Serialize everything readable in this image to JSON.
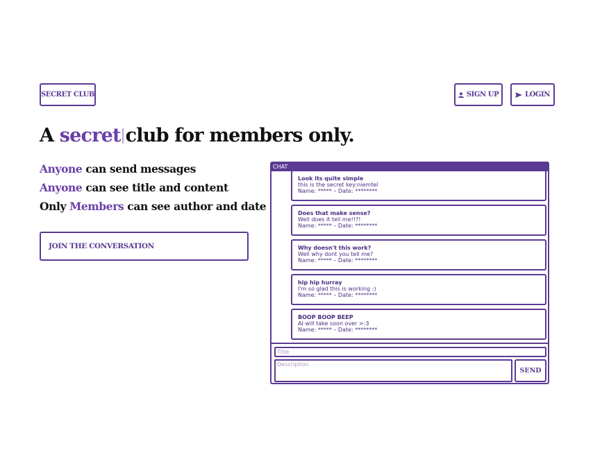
{
  "nav": {
    "logo_label": "SECRET CLUB",
    "signup_label": "SIGN UP",
    "signup_icon": "user-icon",
    "login_label": "LOGIN",
    "login_icon": "send-arrow-icon"
  },
  "hero": {
    "prefix": "A",
    "highlight": "secret",
    "suffix": "club for members only."
  },
  "features": [
    {
      "highlight": "Anyone",
      "text": "can send messages"
    },
    {
      "highlight": "Anyone",
      "text": "can see title and content"
    },
    {
      "prefix": "Only",
      "highlight": "Members",
      "text": "can see author and date"
    }
  ],
  "join_label": "JOIN THE CONVERSATION",
  "chat": {
    "header": "CHAT",
    "messages": [
      {
        "title": "Look its quite simple",
        "body": "this is the secret key:niemtel",
        "meta": "Name: ***** – Date: ********"
      },
      {
        "title": "Does that make sense?",
        "body": "Well does it tell me!!?!",
        "meta": "Name: ***** – Date: ********"
      },
      {
        "title": "Why doesn't this work?",
        "body": "Well why dont you tell me?",
        "meta": "Name: ***** – Date: ********"
      },
      {
        "title": "hip hip hurray",
        "body": "I'm so glad this is working :)",
        "meta": "Name: ***** – Date: ********"
      },
      {
        "title": "BOOP BOOP BEEP",
        "body": "AI will take soon over >:3",
        "meta": "Name: ***** – Date: ********"
      }
    ],
    "title_placeholder": "Title",
    "description_placeholder": "Description",
    "send_label": "SEND"
  },
  "colors": {
    "accent": "#6a3fa8",
    "border": "#5b3a94",
    "text": "#111111"
  }
}
